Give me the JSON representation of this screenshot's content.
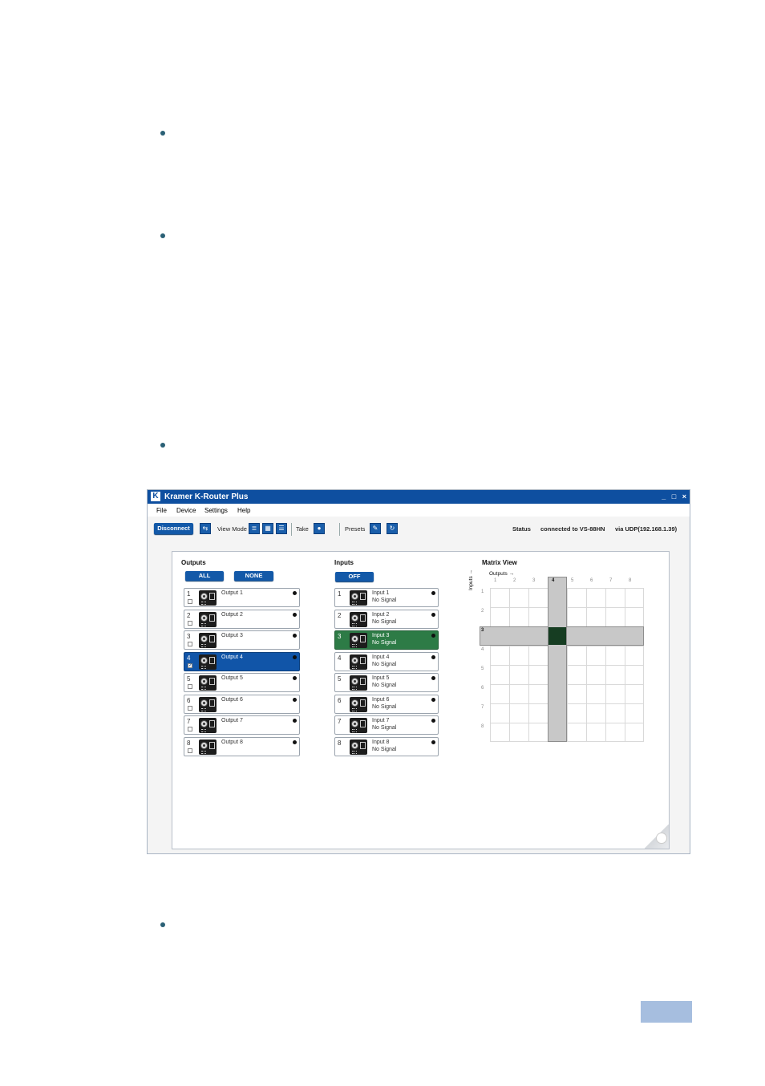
{
  "window": {
    "logo_letter": "K",
    "title": "Kramer K-Router Plus",
    "controls": [
      "_",
      "□",
      "×"
    ]
  },
  "menu": [
    "File",
    "Device",
    "Settings",
    "Help"
  ],
  "toolbar": {
    "disconnect": "Disconnect",
    "view_mode": "View Mode",
    "take": "Take",
    "presets": "Presets",
    "status_label": "Status",
    "status_text": "connected to VS-88HN",
    "via_text": "via UDP(192.168.1.39)"
  },
  "outputs": {
    "title": "Outputs",
    "all": "ALL",
    "none": "NONE",
    "items": [
      {
        "num": "1",
        "name": "Output 1",
        "check": ""
      },
      {
        "num": "2",
        "name": "Output 2",
        "check": ""
      },
      {
        "num": "3",
        "name": "Output 3",
        "check": ""
      },
      {
        "num": "4",
        "name": "Output 4",
        "check": "✓"
      },
      {
        "num": "5",
        "name": "Output 5",
        "check": ""
      },
      {
        "num": "6",
        "name": "Output 6",
        "check": ""
      },
      {
        "num": "7",
        "name": "Output 7",
        "check": ""
      },
      {
        "num": "8",
        "name": "Output 8",
        "check": ""
      }
    ],
    "selected_index": 3
  },
  "inputs": {
    "title": "Inputs",
    "off": "OFF",
    "items": [
      {
        "num": "1",
        "name": "Input 1",
        "signal": "No Signal"
      },
      {
        "num": "2",
        "name": "Input 2",
        "signal": "No Signal"
      },
      {
        "num": "3",
        "name": "Input 3",
        "signal": "No Signal"
      },
      {
        "num": "4",
        "name": "Input 4",
        "signal": "No Signal"
      },
      {
        "num": "5",
        "name": "Input 5",
        "signal": "No Signal"
      },
      {
        "num": "6",
        "name": "Input 6",
        "signal": "No Signal"
      },
      {
        "num": "7",
        "name": "Input 7",
        "signal": "No Signal"
      },
      {
        "num": "8",
        "name": "Input 8",
        "signal": "No Signal"
      }
    ],
    "selected_index": 2
  },
  "matrix": {
    "title": "Matrix View",
    "outputs_label": "Outputs",
    "inputs_label": "Inputs",
    "col_labels": [
      "1",
      "2",
      "3",
      "4",
      "5",
      "6",
      "7",
      "8"
    ],
    "row_labels": [
      "1",
      "2",
      "3",
      "4",
      "5",
      "6",
      "7",
      "8"
    ],
    "active_output": 4,
    "active_input": 3
  },
  "colors": {
    "title_bar": "#0e4fa0",
    "selected_output": "#1155a8",
    "selected_input": "#2d7b46",
    "matrix_active": "#163d22"
  }
}
